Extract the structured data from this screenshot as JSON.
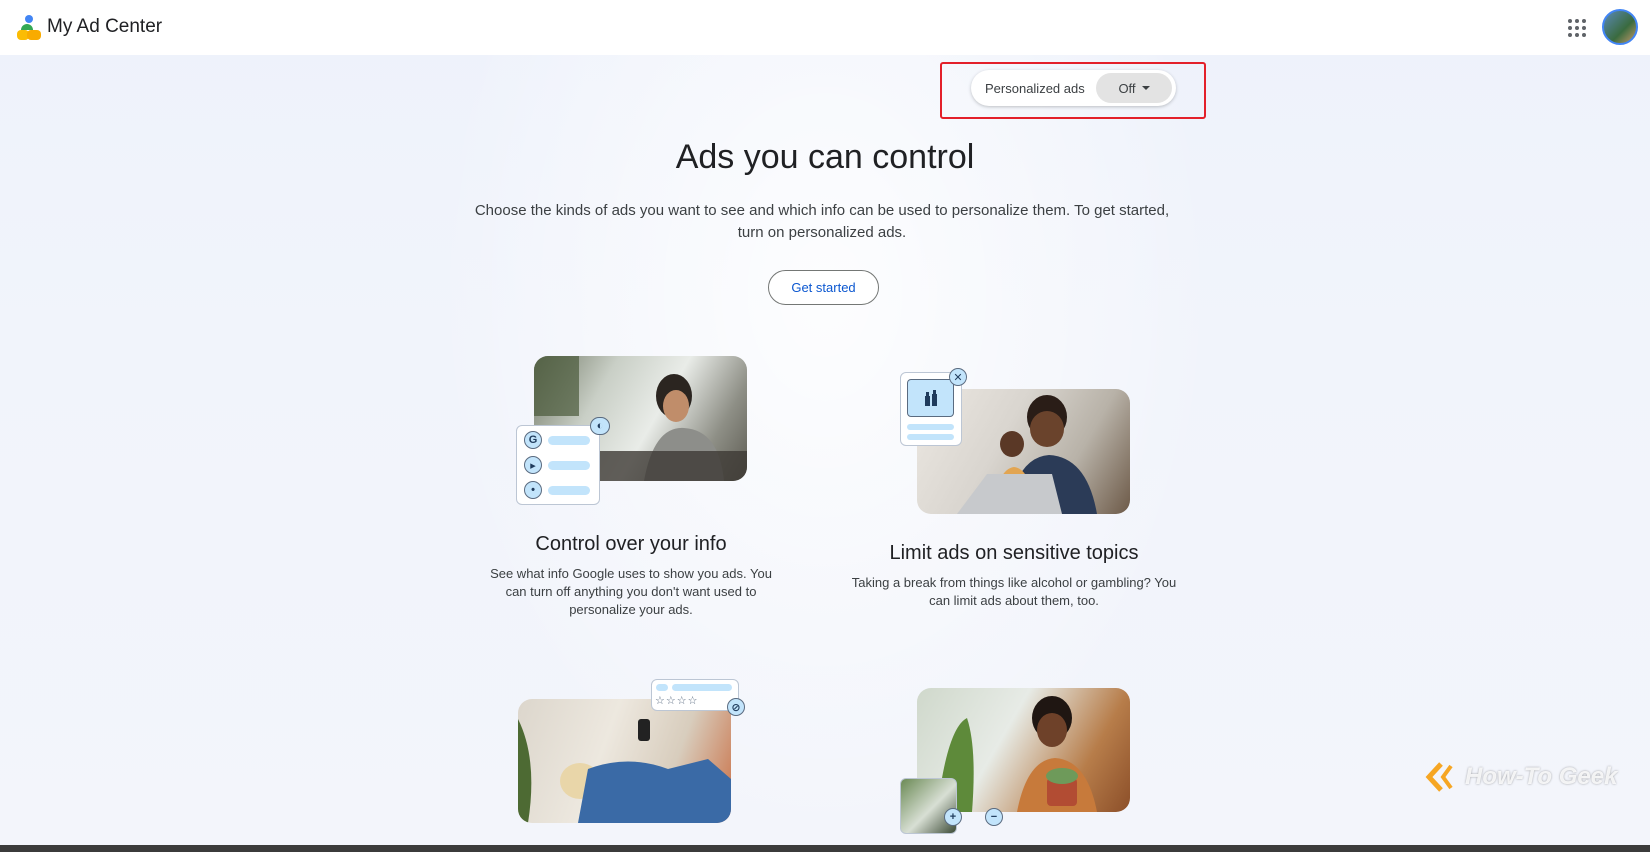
{
  "header": {
    "app_title": "My Ad Center",
    "logo_icon": "my-ad-center-logo-icon",
    "apps_icon": "apps-grid-icon",
    "avatar_icon": "account-avatar"
  },
  "personalized_ads": {
    "label": "Personalized ads",
    "value": "Off",
    "highlight_color": "#e3202a"
  },
  "hero": {
    "title": "Ads you can control",
    "description": "Choose the kinds of ads you want to see and which info can be used to personalize them. To get started, turn on personalized ads.",
    "cta_label": "Get started"
  },
  "cards": [
    {
      "title": "Control over your info",
      "description": "See what info Google uses to show you ads. You can turn off anything you don't want used to personalize your ads."
    },
    {
      "title": "Limit ads on sensitive topics",
      "description": "Taking a break from things like alcohol or gambling? You can limit ads about them, too."
    }
  ],
  "watermark": "How-To Geek",
  "colors": {
    "accent_blue": "#0b57d0",
    "light_blue": "#c2e4fb"
  }
}
